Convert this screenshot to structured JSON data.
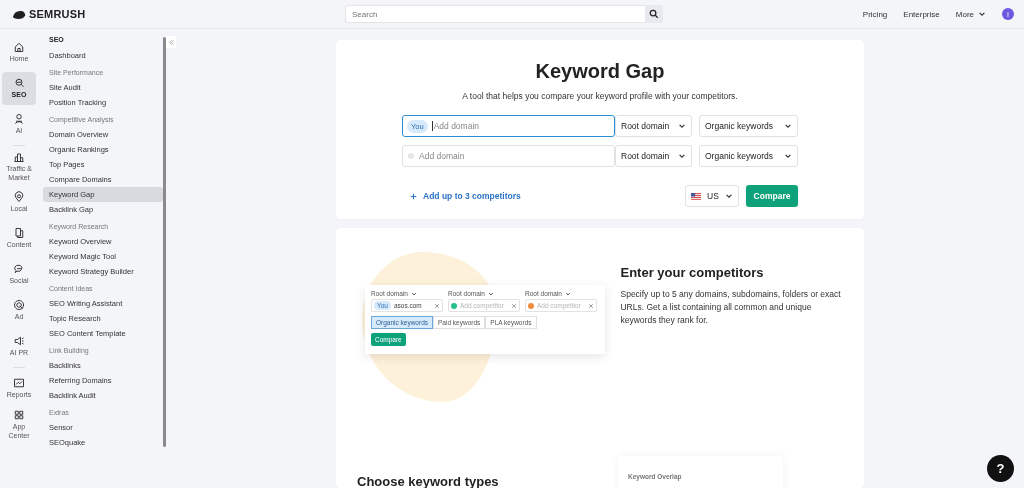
{
  "header": {
    "logo": "SEMRUSH",
    "search": {
      "placeholder": "Search"
    },
    "links": [
      "Pricing",
      "Enterprise"
    ],
    "more": "More",
    "avatar": "I"
  },
  "rail": [
    {
      "kind": "home",
      "label": "Home",
      "selected": false
    },
    {
      "kind": "seo",
      "label": "SEO",
      "selected": true
    },
    {
      "kind": "ai",
      "label": "AI",
      "selected": false
    },
    {
      "kind": "traffic",
      "label": "Traffic & Market",
      "selected": false
    },
    {
      "kind": "local",
      "label": "Local",
      "selected": false
    },
    {
      "kind": "content",
      "label": "Content",
      "selected": false
    },
    {
      "kind": "social",
      "label": "Social",
      "selected": false
    },
    {
      "kind": "ad",
      "label": "Ad",
      "selected": false
    },
    {
      "kind": "aipr",
      "label": "AI PR",
      "selected": false
    },
    {
      "kind": "reports",
      "label": "Reports",
      "selected": false
    },
    {
      "kind": "apps",
      "label": "App Center",
      "selected": false
    }
  ],
  "nav": {
    "title": "SEO",
    "sections": [
      {
        "items": [
          {
            "label": "Dashboard",
            "selected": false
          }
        ]
      },
      {
        "heading": "Site Performance",
        "items": [
          {
            "label": "Site Audit",
            "selected": false
          },
          {
            "label": "Position Tracking",
            "selected": false
          }
        ]
      },
      {
        "heading": "Competitive Analysis",
        "items": [
          {
            "label": "Domain Overview",
            "selected": false
          },
          {
            "label": "Organic Rankings",
            "selected": false
          },
          {
            "label": "Top Pages",
            "selected": false
          },
          {
            "label": "Compare Domains",
            "selected": false
          },
          {
            "label": "Keyword Gap",
            "selected": true
          },
          {
            "label": "Backlink Gap",
            "selected": false
          }
        ]
      },
      {
        "heading": "Keyword Research",
        "items": [
          {
            "label": "Keyword Overview",
            "selected": false
          },
          {
            "label": "Keyword Magic Tool",
            "selected": false
          },
          {
            "label": "Keyword Strategy Builder",
            "selected": false
          }
        ]
      },
      {
        "heading": "Content Ideas",
        "items": [
          {
            "label": "SEO Writing Assistant",
            "selected": false
          },
          {
            "label": "Topic Research",
            "selected": false
          },
          {
            "label": "SEO Content Template",
            "selected": false
          }
        ]
      },
      {
        "heading": "Link Building",
        "items": [
          {
            "label": "Backlinks",
            "selected": false
          },
          {
            "label": "Referring Domains",
            "selected": false
          },
          {
            "label": "Backlink Audit",
            "selected": false
          }
        ]
      },
      {
        "heading": "Extras",
        "items": [
          {
            "label": "Sensor",
            "selected": false
          },
          {
            "label": "SEOquake",
            "selected": false
          }
        ]
      }
    ]
  },
  "tool": {
    "title": "Keyword Gap",
    "subtitle": "A tool that helps you compare your keyword profile with your competitors.",
    "rows": [
      {
        "tag": "You",
        "placeholder": "Add domain",
        "focused": true,
        "scope": "Root domain",
        "type": "Organic keywords"
      },
      {
        "placeholder": "Add domain",
        "focused": false,
        "scope": "Root domain",
        "type": "Organic keywords"
      }
    ],
    "add_link": "Add up to 3 competitors",
    "country": "US",
    "compare": "Compare"
  },
  "intro": {
    "heading": "Enter your competitors",
    "text": "Specify up to 5 any domains, subdomains, folders or exact URLs. Get a list containing all common and unique keywords they rank for.",
    "illustration": {
      "fields": [
        {
          "scope": "Root domain",
          "tag": "You",
          "value": "asos.com"
        },
        {
          "scope": "Root domain",
          "placeholder": "Add competitor",
          "color": "#22c08e"
        },
        {
          "scope": "Root domain",
          "placeholder": "Add competitor",
          "color": "#f08a3c"
        }
      ],
      "tabs": [
        {
          "label": "Organic keywords",
          "selected": true
        },
        {
          "label": "Paid keywords",
          "selected": false
        },
        {
          "label": "PLA keywords",
          "selected": false
        }
      ],
      "compare": "Compare"
    },
    "heading2": "Choose keyword types",
    "overlap_title": "Keyword Overlap"
  },
  "help": "?"
}
